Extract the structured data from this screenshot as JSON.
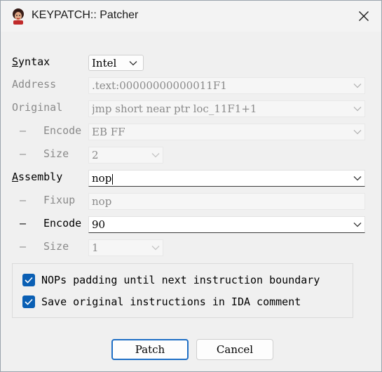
{
  "window": {
    "title": "KEYPATCH:: Patcher",
    "close_icon": "close-icon",
    "app_icon": "keypatch-app-icon"
  },
  "form": {
    "syntax": {
      "label_first": "S",
      "label_rest": "yntax",
      "value": "Intel"
    },
    "address": {
      "label": "Address",
      "value": ".text:00000000000011F1"
    },
    "original": {
      "label": "Original",
      "value": "jmp short near ptr loc_11F1+1"
    },
    "original_encode": {
      "dash": "–",
      "label": "Encode",
      "value": "EB FF"
    },
    "original_size": {
      "dash": "–",
      "label": "Size",
      "value": "2"
    },
    "assembly": {
      "label_first": "A",
      "label_rest": "ssembly",
      "value": "nop"
    },
    "fixup": {
      "dash": "–",
      "label": "Fixup",
      "value": "nop"
    },
    "new_encode": {
      "dash": "–",
      "label": "Encode",
      "value": "90"
    },
    "new_size": {
      "dash": "–",
      "label": "Size",
      "value": "1"
    }
  },
  "options": {
    "nop_padding": {
      "label": "NOPs padding until next instruction boundary",
      "checked": true
    },
    "save_comment": {
      "label": "Save original instructions in IDA comment",
      "checked": true
    }
  },
  "buttons": {
    "patch": "Patch",
    "cancel": "Cancel"
  },
  "colors": {
    "accent": "#0a5fb4",
    "disabled_text": "#8a8a8a",
    "primary_border": "#1f6fc5"
  }
}
